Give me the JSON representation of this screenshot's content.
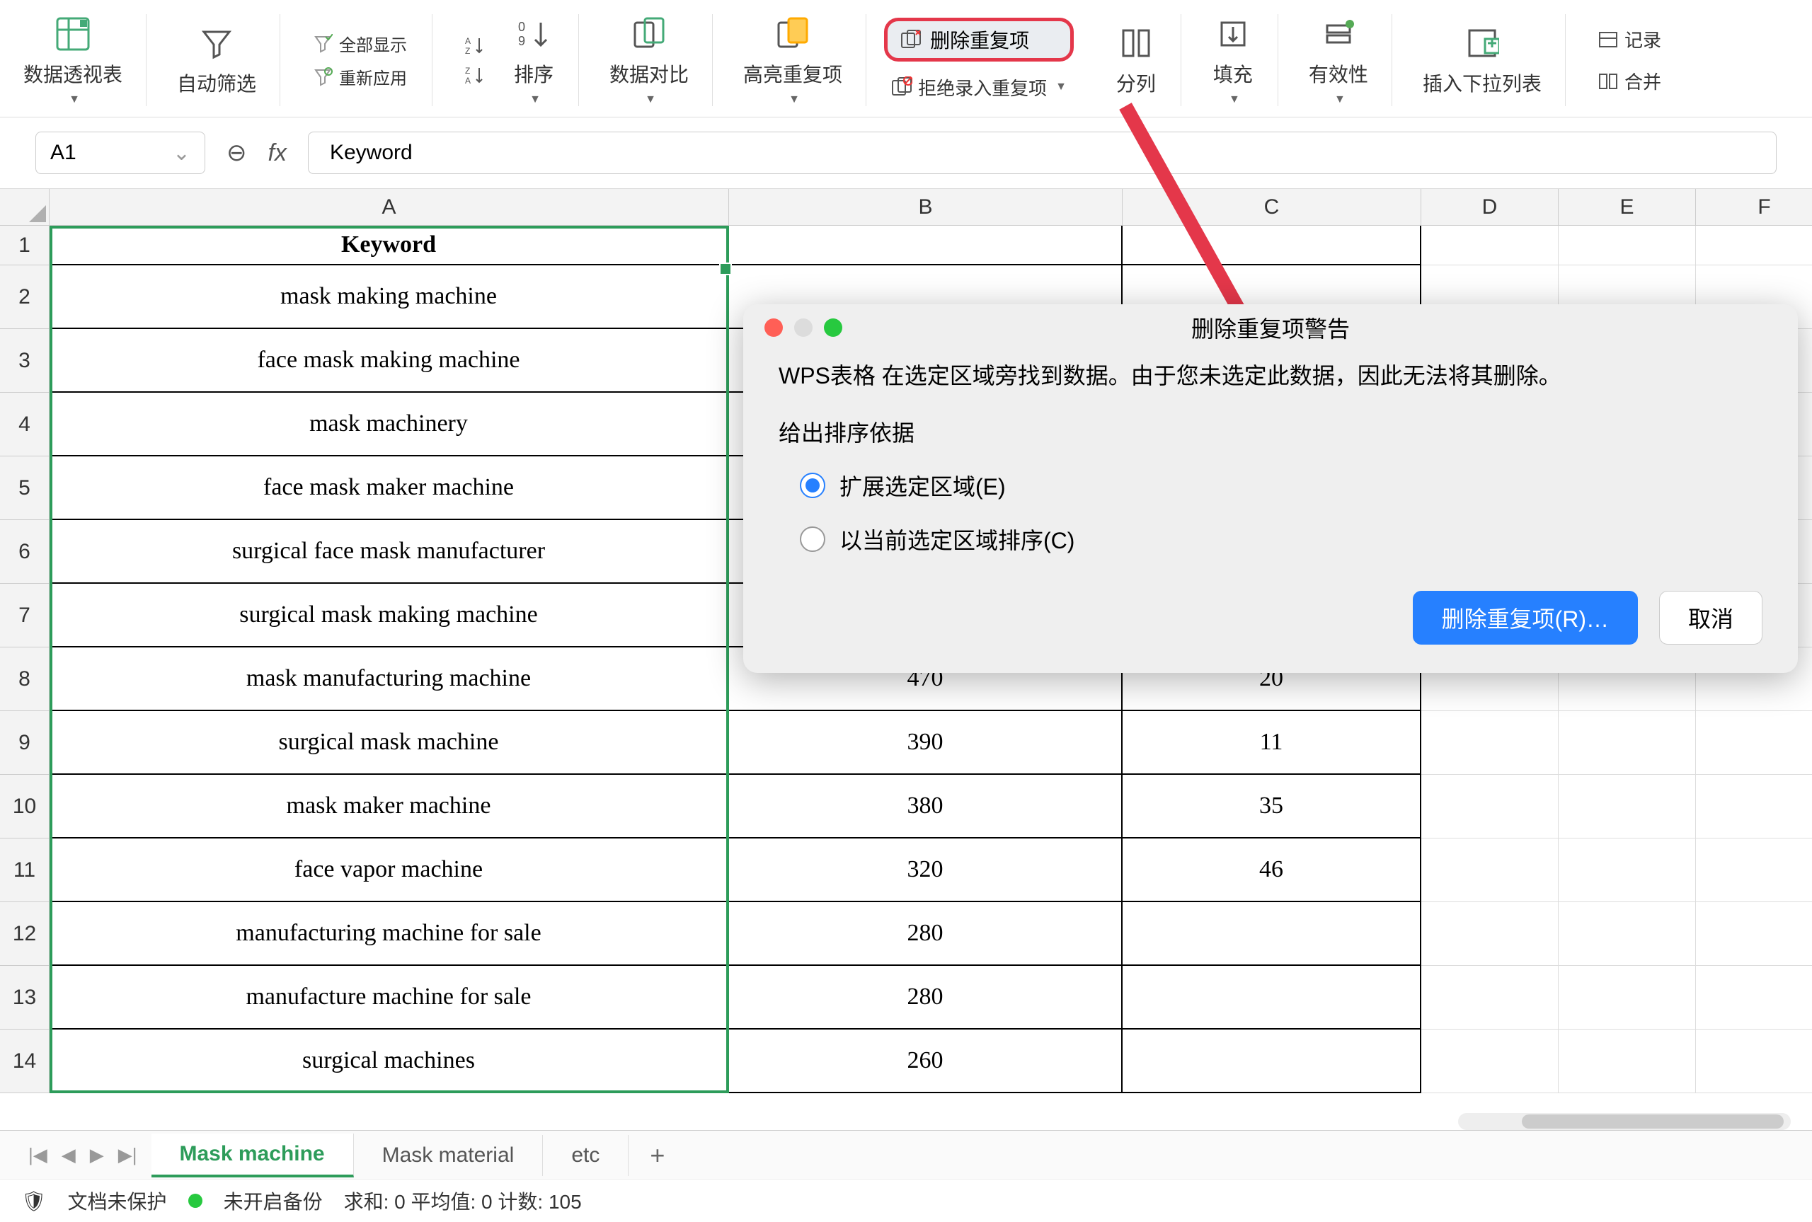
{
  "toolbar": {
    "pivot": "数据透视表",
    "autofilter": "自动筛选",
    "showall": "全部显示",
    "reapply": "重新应用",
    "sort": "排序",
    "datacompare": "数据对比",
    "highlightdup": "高亮重复项",
    "removedup": "删除重复项",
    "rejectdup": "拒绝录入重复项",
    "splitcol": "分列",
    "fill": "填充",
    "validity": "有效性",
    "insertdropdown": "插入下拉列表",
    "record": "记录",
    "merge": "合并"
  },
  "formula": {
    "cellref": "A1",
    "content": "Keyword"
  },
  "columns": [
    "A",
    "B",
    "C",
    "D",
    "E",
    "F"
  ],
  "rows": [
    "1",
    "2",
    "3",
    "4",
    "5",
    "6",
    "7",
    "8",
    "9",
    "10",
    "11",
    "12",
    "13",
    "14"
  ],
  "table": {
    "header": "Keyword",
    "data": [
      {
        "a": "mask making machine",
        "b": "",
        "c": ""
      },
      {
        "a": "face mask making machine",
        "b": "",
        "c": ""
      },
      {
        "a": "mask machinery",
        "b": "",
        "c": ""
      },
      {
        "a": "face mask maker machine",
        "b": "",
        "c": ""
      },
      {
        "a": "surgical face mask manufacturer",
        "b": "",
        "c": ""
      },
      {
        "a": "surgical mask making machine",
        "b": "",
        "c": ""
      },
      {
        "a": "mask manufacturing machine",
        "b": "470",
        "c": "20"
      },
      {
        "a": "surgical mask machine",
        "b": "390",
        "c": "11"
      },
      {
        "a": "mask maker machine",
        "b": "380",
        "c": "35"
      },
      {
        "a": "face vapor machine",
        "b": "320",
        "c": "46"
      },
      {
        "a": "manufacturing machine for sale",
        "b": "280",
        "c": ""
      },
      {
        "a": "manufacture machine for sale",
        "b": "280",
        "c": ""
      },
      {
        "a": "surgical machines",
        "b": "260",
        "c": ""
      }
    ]
  },
  "dialog": {
    "title": "删除重复项警告",
    "message": "WPS表格 在选定区域旁找到数据。由于您未选定此数据，因此无法将其删除。",
    "subtitle": "给出排序依据",
    "opt1": "扩展选定区域(E)",
    "opt2": "以当前选定区域排序(C)",
    "confirm": "删除重复项(R)…",
    "cancel": "取消"
  },
  "sheets": {
    "s1": "Mask machine",
    "s2": "Mask material",
    "s3": "etc"
  },
  "status": {
    "protect": "文档未保护",
    "backup": "未开启备份",
    "calc": "求和: 0  平均值: 0  计数: 105"
  }
}
